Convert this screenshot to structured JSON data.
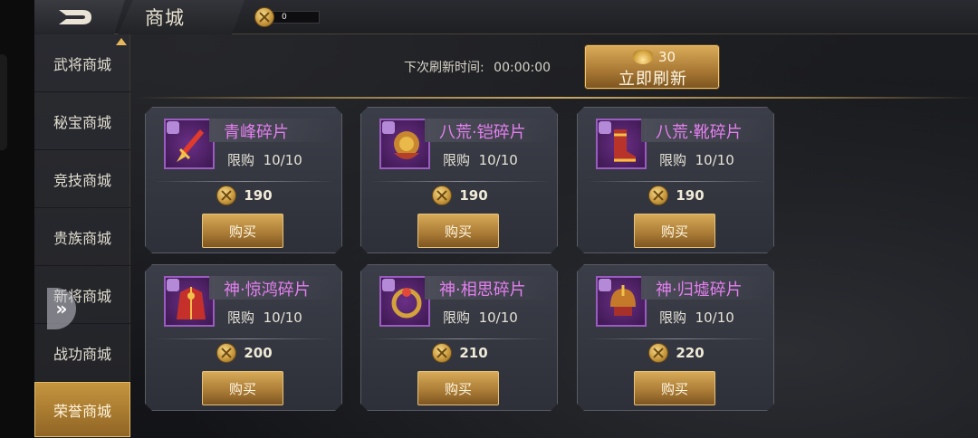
{
  "header": {
    "title": "商城",
    "currency_value": "0"
  },
  "sidebar": {
    "items": [
      {
        "label": "武将商城"
      },
      {
        "label": "秘宝商城"
      },
      {
        "label": "竞技商城"
      },
      {
        "label": "贵族商城"
      },
      {
        "label": "新将商城"
      },
      {
        "label": "战功商城"
      },
      {
        "label": "荣誉商城"
      }
    ],
    "active_index": 6
  },
  "refresh": {
    "label": "下次刷新时间:",
    "time": "00:00:00",
    "cost": "30",
    "button_label": "立即刷新"
  },
  "items": [
    {
      "name": "青峰碎片",
      "limit_label": "限购",
      "limit": "10/10",
      "price": "190",
      "buy_label": "购买",
      "icon": "sword-icon"
    },
    {
      "name": "八荒·铠碎片",
      "limit_label": "限购",
      "limit": "10/10",
      "price": "190",
      "buy_label": "购买",
      "icon": "armor-icon"
    },
    {
      "name": "八荒·靴碎片",
      "limit_label": "限购",
      "limit": "10/10",
      "price": "190",
      "buy_label": "购买",
      "icon": "boots-icon"
    },
    {
      "name": "神·惊鸿碎片",
      "limit_label": "限购",
      "limit": "10/10",
      "price": "200",
      "buy_label": "购买",
      "icon": "robe-icon"
    },
    {
      "name": "神·相思碎片",
      "limit_label": "限购",
      "limit": "10/10",
      "price": "210",
      "buy_label": "购买",
      "icon": "ring-icon"
    },
    {
      "name": "神·归墟碎片",
      "limit_label": "限购",
      "limit": "10/10",
      "price": "220",
      "buy_label": "购买",
      "icon": "helmet-icon"
    }
  ],
  "colors": {
    "gold": "#c9973f",
    "fragment_name": "#e47ff0",
    "card_bg": "#353842"
  }
}
